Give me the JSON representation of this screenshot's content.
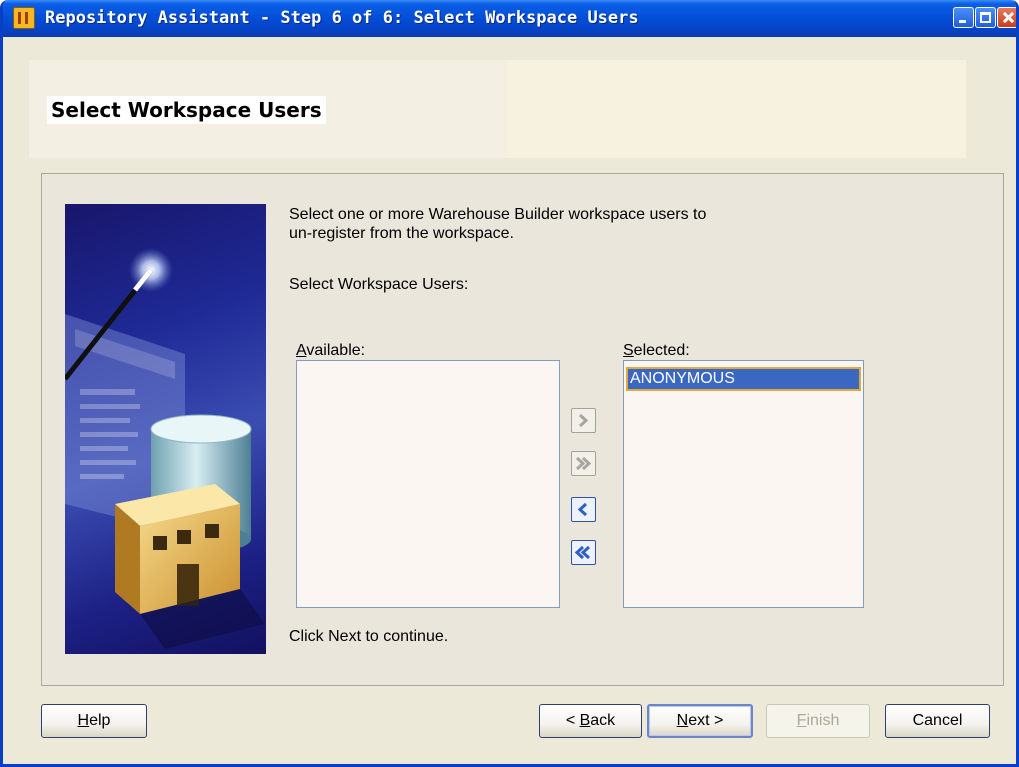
{
  "window": {
    "title": "Repository Assistant - Step 6 of 6: Select Workspace Users"
  },
  "header": {
    "title": "Select Workspace Users"
  },
  "instructions": {
    "line1": "Select one or more Warehouse Builder workspace users to",
    "line2": "un-register from the workspace.",
    "select_label": "Select Workspace Users:",
    "footer_hint": "Click Next to continue."
  },
  "available": {
    "label_mnemonic": "A",
    "label_rest": "vailable:",
    "items": []
  },
  "selected": {
    "label_mnemonic": "S",
    "label_rest": "elected:",
    "items": [
      "ANONYMOUS"
    ]
  },
  "shuttle": {
    "move_right_icon": "chevron-right-icon",
    "move_all_right_icon": "double-chevron-right-icon",
    "move_left_icon": "chevron-left-icon",
    "move_all_left_icon": "double-chevron-left-icon"
  },
  "buttons": {
    "help_mnemonic": "H",
    "help_rest": "elp",
    "back_prefix": "< ",
    "back_mnemonic": "B",
    "back_rest": "ack",
    "next_mnemonic": "N",
    "next_rest": "ext >",
    "finish_mnemonic": "F",
    "finish_rest": "inish",
    "cancel": "Cancel"
  },
  "colors": {
    "titlebar": "#0350d8",
    "selection": "#3a67c2",
    "selection_border": "#e3a83c",
    "dialog_bg": "#ece9d8"
  }
}
